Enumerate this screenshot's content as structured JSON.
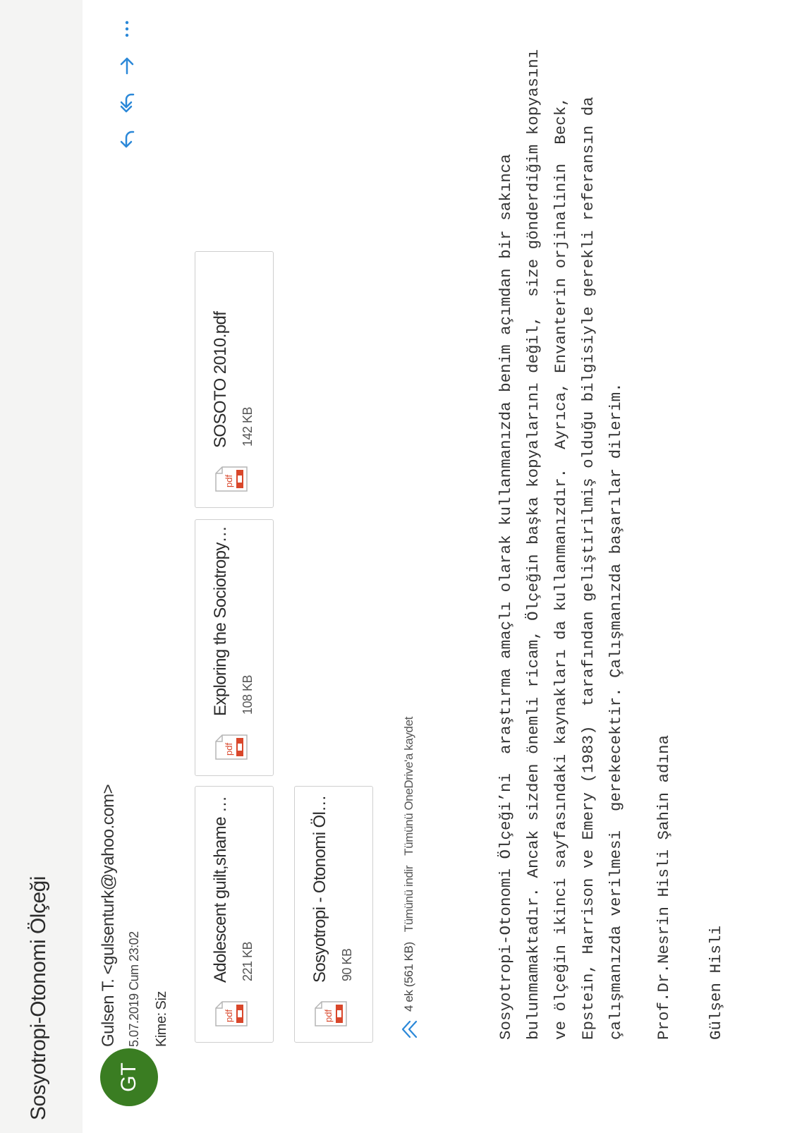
{
  "email": {
    "subject": "Sosyotropi-Otonomi Ölçeği",
    "avatar_initials": "GT",
    "sender": "Gulsen T. <gulsenturk@yahoo.com>",
    "date": "5.07.2019 Cum 23:02",
    "to_label": "Kime:",
    "to_value": "Siz"
  },
  "actions": {
    "icons": [
      "reply-icon",
      "reply-all-icon",
      "forward-icon",
      "more-options-icon"
    ]
  },
  "attachments": {
    "items": [
      {
        "name": "Adolescent guilt,shame and d...",
        "size": "221 KB",
        "icon": "pdf-icon"
      },
      {
        "name": "Exploring the Sociotropy-Aut...",
        "size": "108 KB",
        "icon": "pdf-icon"
      },
      {
        "name": "SOSOTO 2010.pdf",
        "size": "142 KB",
        "icon": "pdf-icon"
      },
      {
        "name": "Sosyotropi - Otonomi Ölçeği ...",
        "size": "90 KB",
        "icon": "pdf-icon"
      }
    ],
    "summary": "4 ek (561 KB)",
    "download_all": "Tümünü indir",
    "save_onedrive": "Tümünü OneDrive'a kaydet"
  },
  "body": {
    "lines": [
      "Sosyotropi-Otonomi Ölçeği’ni  araştırma amaçlı olarak kullanmanızda benim açımdan bir sakınca",
      "bulunmamaktadır. Ancak sizden önemli ricam, Ölçeğin başka kopyalarını değil,  size gönderdiğim kopyasını",
      "ve ölçeğin ikinci sayfasındaki kaynakları da kullanmanızdır.  Ayrıca, Envanterin orjinalinin  Beck,",
      "Epstein, Harrison ve Emery (1983)  tarafından geliştirilmiş olduğu bilgisiyle gerekli referansın da",
      "çalışmanızda verilmesi  gerekecektir. Çalışmanızda başarılar dilerim."
    ],
    "signature_1": "Prof.Dr.Nesrin Hisli Şahin adına",
    "signature_2": "Gülşen Hisli"
  },
  "colors": {
    "accent": "#2b88d8",
    "avatar": "#3a7d22",
    "pdf_red": "#d9472b",
    "header_bg": "#f4f4f3"
  }
}
